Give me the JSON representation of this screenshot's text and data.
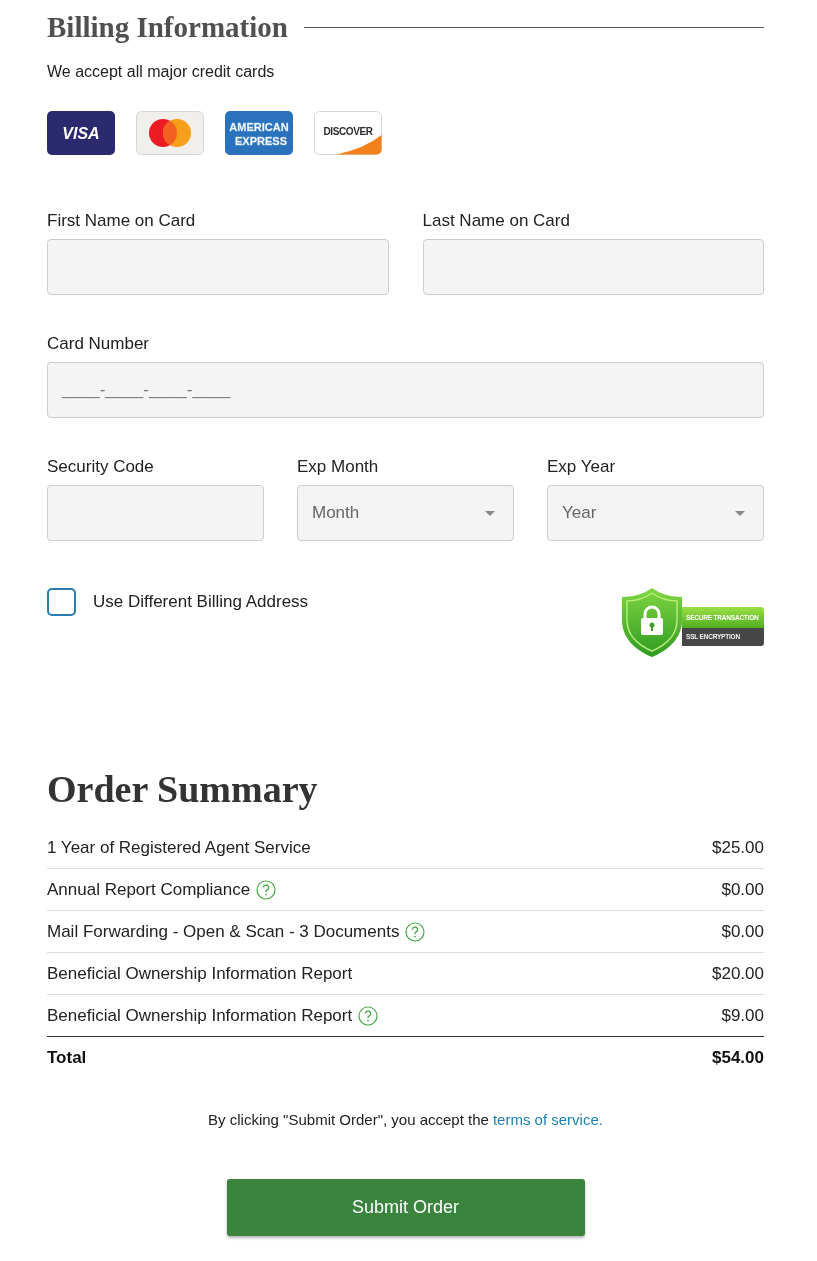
{
  "billing": {
    "title": "Billing Information",
    "note": "We accept all major credit cards",
    "cards": [
      {
        "kind": "visa",
        "text": [
          "VISA"
        ]
      },
      {
        "kind": "mastercard"
      },
      {
        "kind": "amex",
        "text": [
          "AMERICAN",
          "EXPRESS"
        ]
      },
      {
        "kind": "discover",
        "text": [
          "DISCOVER"
        ]
      }
    ]
  },
  "form": {
    "rows": [
      [
        {
          "label": "First Name on Card",
          "kind": "text"
        },
        {
          "label": "Last Name on Card",
          "kind": "text"
        }
      ],
      [
        {
          "label": "Card Number",
          "kind": "text",
          "placeholder": "____-____-____-____"
        }
      ],
      [
        {
          "label": "Security Code",
          "kind": "text"
        },
        {
          "label": "Exp Month",
          "kind": "select",
          "placeholder": "Month"
        },
        {
          "label": "Exp Year",
          "kind": "select",
          "placeholder": "Year"
        }
      ]
    ]
  },
  "billing_address": {
    "label": "Use Different Billing Address",
    "checked": false
  },
  "ssl_badge": {
    "lines": [
      "SECURE TRANSACTION",
      "SSL ENCRYPTION"
    ]
  },
  "order_summary": {
    "title": "Order Summary",
    "items": [
      {
        "name": "1 Year of Registered Agent Service",
        "help": false,
        "price": "$25.00"
      },
      {
        "name": "Annual Report Compliance",
        "help": true,
        "price": "$0.00"
      },
      {
        "name": "Mail Forwarding - Open & Scan - 3 Documents",
        "help": true,
        "price": "$0.00"
      },
      {
        "name": "Beneficial Ownership Information Report",
        "help": false,
        "price": "$20.00"
      },
      {
        "name": "Beneficial Ownership Information Report",
        "help": true,
        "price": "$9.00"
      }
    ],
    "total": {
      "label": "Total",
      "amount": "$54.00"
    }
  },
  "terms": {
    "text": "By clicking \"Submit Order\", you accept the",
    "link": "terms of service."
  },
  "submit_button": "Submit Order"
}
